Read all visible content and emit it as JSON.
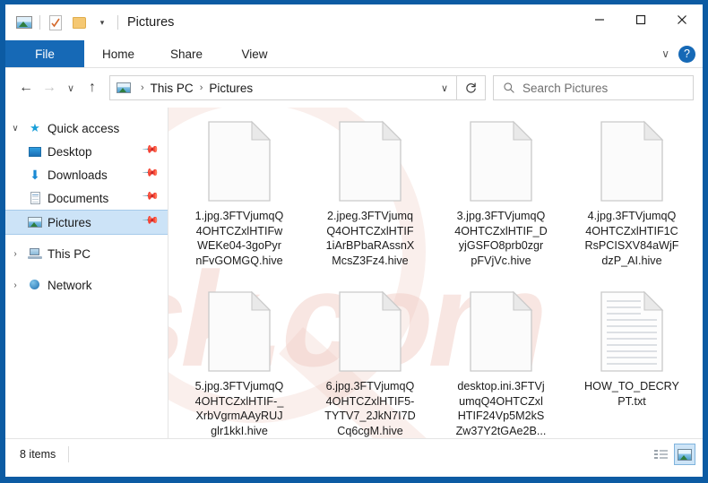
{
  "window": {
    "title": "Pictures",
    "minimize_label": "─",
    "maximize_label": "☐",
    "close_label": "✕"
  },
  "quick_access_toolbar": {
    "items": [
      {
        "name": "pictures-icon",
        "label": ""
      },
      {
        "name": "properties-icon",
        "label": ""
      },
      {
        "name": "new-folder-icon",
        "label": ""
      },
      {
        "name": "customize-caret",
        "label": "▾"
      }
    ]
  },
  "ribbon": {
    "tabs": [
      {
        "label": "File",
        "selected": true
      },
      {
        "label": "Home",
        "selected": false
      },
      {
        "label": "Share",
        "selected": false
      },
      {
        "label": "View",
        "selected": false
      }
    ],
    "expand_caret": "∨",
    "help_label": "?",
    "file_tab_color": "#1669b6"
  },
  "navigation": {
    "back": "←",
    "forward": "→",
    "recent": "∨",
    "up": "↑",
    "address_caret": "∨",
    "refresh": "↻",
    "breadcrumbs": [
      "This PC",
      "Pictures"
    ],
    "separator": "›"
  },
  "search": {
    "placeholder": "Search Pictures",
    "icon": "search-icon"
  },
  "sidebar": {
    "items": [
      {
        "label": "Quick access",
        "icon": "star-icon",
        "chevron": "∨",
        "pinned": false,
        "selected": false,
        "indent": false
      },
      {
        "label": "Desktop",
        "icon": "desktop-icon",
        "chevron": "",
        "pinned": true,
        "selected": false,
        "indent": true
      },
      {
        "label": "Downloads",
        "icon": "download-icon",
        "chevron": "",
        "pinned": true,
        "selected": false,
        "indent": true
      },
      {
        "label": "Documents",
        "icon": "document-icon",
        "chevron": "",
        "pinned": true,
        "selected": false,
        "indent": true
      },
      {
        "label": "Pictures",
        "icon": "pictures-icon",
        "chevron": "",
        "pinned": true,
        "selected": true,
        "indent": true
      },
      {
        "label": "This PC",
        "icon": "this-pc-icon",
        "chevron": "›",
        "pinned": false,
        "selected": false,
        "indent": false
      },
      {
        "label": "Network",
        "icon": "network-icon",
        "chevron": "›",
        "pinned": false,
        "selected": false,
        "indent": false
      }
    ],
    "pin_glyph": "📌",
    "selected_color": "#cce3f7"
  },
  "files": [
    {
      "name": "1.jpg.3FTVjumqQ4OHTCZxlHTIFwWEKe04-3goPyrnFvGOMGQ.hive",
      "display": "1.jpg.3FTVjumqQ\n4OHTCZxlHTIFw\nWEKe04-3goPyr\nnFvGOMGQ.hive",
      "type": "blank-document"
    },
    {
      "name": "2.jpeg.3FTVjumqQ4OHTCZxlHTIF1iArBPbaRAssnXMcsZ3Fz4.hive",
      "display": "2.jpeg.3FTVjumq\nQ4OHTCZxlHTIF\n1iArBPbaRAssnX\nMcsZ3Fz4.hive",
      "type": "blank-document"
    },
    {
      "name": "3.jpg.3FTVjumqQ4OHTCZxlHTIF_DyjGSFO8prb0zgrpFVjVc.hive",
      "display": "3.jpg.3FTVjumqQ\n4OHTCZxlHTIF_D\nyjGSFO8prb0zgr\npFVjVc.hive",
      "type": "blank-document"
    },
    {
      "name": "4.jpg.3FTVjumqQ4OHTCZxlHTIF1CRsPCISXV84aWjFdzP_AI.hive",
      "display": "4.jpg.3FTVjumqQ\n4OHTCZxlHTIF1C\nRsPCISXV84aWjF\ndzP_AI.hive",
      "type": "blank-document"
    },
    {
      "name": "5.jpg.3FTVjumqQ4OHTCZxlHTIF-_XrbVgrmAAyRUJglr1kkI.hive",
      "display": "5.jpg.3FTVjumqQ\n4OHTCZxlHTIF-_\nXrbVgrmAAyRUJ\nglr1kkI.hive",
      "type": "blank-document"
    },
    {
      "name": "6.jpg.3FTVjumqQ4OHTCZxlHTIF5-TYTV7_2JkN7I7DCq6cgM.hive",
      "display": "6.jpg.3FTVjumqQ\n4OHTCZxlHTIF5-\nTYTV7_2JkN7I7D\nCq6cgM.hive",
      "type": "blank-document"
    },
    {
      "name": "desktop.ini.3FTVjumqQ4OHTCZxlHTIF24Vp5M2kSZw37Y2tGAe2B...",
      "display": "desktop.ini.3FTVj\numqQ4OHTCZxl\nHTIF24Vp5M2kS\nZw37Y2tGAe2B...",
      "type": "blank-document"
    },
    {
      "name": "HOW_TO_DECRYPT.txt",
      "display": "HOW_TO_DECRY\nPT.txt",
      "type": "text-document"
    }
  ],
  "status": {
    "item_count": "8 items",
    "view_details_icon": "details-view-icon",
    "view_large_icons_icon": "large-icons-view-icon"
  },
  "watermark": {
    "text": "risk.com"
  }
}
